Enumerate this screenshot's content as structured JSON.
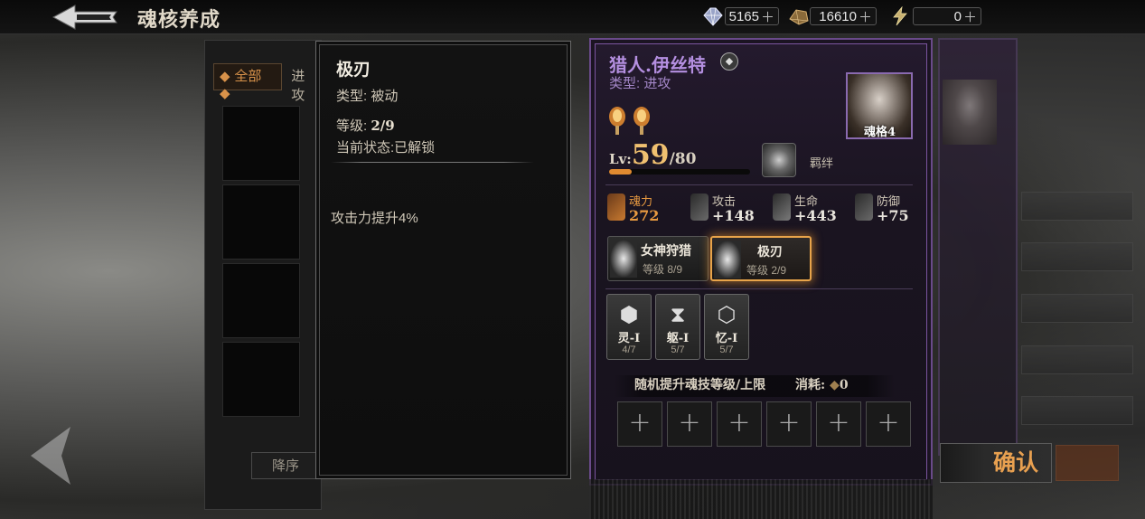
{
  "header": {
    "title": "魂核养成",
    "currencies": [
      {
        "icon": "crystal-icon",
        "value": "5165"
      },
      {
        "icon": "gold-bar-icon",
        "value": "16610"
      },
      {
        "icon": "lightning-icon",
        "value": "0"
      }
    ]
  },
  "list_panel": {
    "tabs": [
      "全部",
      "进攻"
    ],
    "sort_label": "降序"
  },
  "tooltip": {
    "name": "极刃",
    "type_label": "类型:",
    "type_value": "被动",
    "level_label": "等级:",
    "level_value": "2/9",
    "status_label": "当前状态:",
    "status_value": "已解锁",
    "description": "攻击力提升4%"
  },
  "character": {
    "name": "猎人.伊丝特",
    "badge": "◆",
    "type": "类型: 进攻",
    "portrait_label": "魂格4",
    "level_prefix": "Lv:",
    "level": "59",
    "level_max": "/80",
    "level_progress": 0.16,
    "bond_label": "羁绊",
    "stats": [
      {
        "label": "魂力",
        "value": "272",
        "color": "#e89a40"
      },
      {
        "label": "攻击",
        "value": "+148",
        "color": "#e8e4dc"
      },
      {
        "label": "生命",
        "value": "+443",
        "color": "#e8e4dc"
      },
      {
        "label": "防御",
        "value": "+75",
        "color": "#e8e4dc"
      }
    ],
    "skills": [
      {
        "name": "女神狩猎",
        "level": "等级 8/9",
        "selected": false
      },
      {
        "name": "极刃",
        "level": "等级 2/9",
        "selected": true
      }
    ],
    "runes": [
      {
        "name": "灵-Ⅰ",
        "progress": "4/7",
        "glyph": "⬢"
      },
      {
        "name": "躯-Ⅰ",
        "progress": "5/7",
        "glyph": "⧗"
      },
      {
        "name": "忆-Ⅰ",
        "progress": "5/7",
        "glyph": "⬡"
      }
    ],
    "random_upgrade": "随机提升魂技等级/上限",
    "cost_label": "消耗:",
    "cost_value": "0",
    "empty_slots": 6
  },
  "confirm_label": "确认",
  "colors": {
    "accent_purple": "#7b55a0",
    "accent_orange": "#e8a44a"
  }
}
